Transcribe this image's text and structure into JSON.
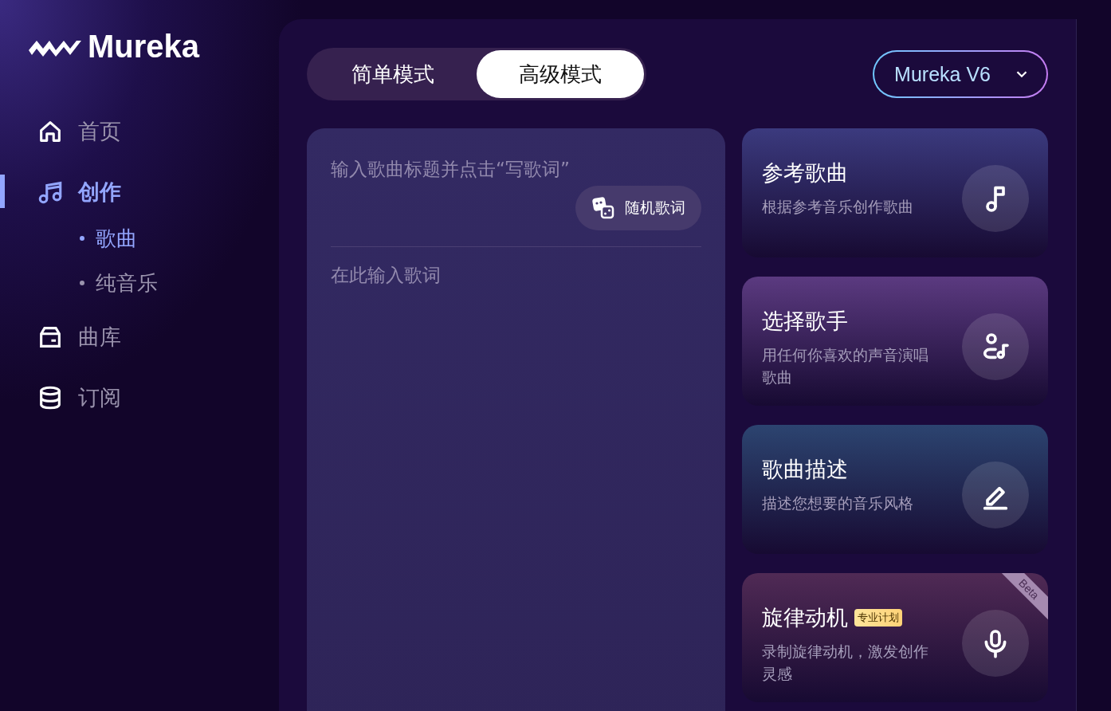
{
  "logo": {
    "text": "Mureka"
  },
  "sidebar": {
    "items": [
      {
        "label": "首页",
        "kind": "home",
        "selected": false
      },
      {
        "label": "创作",
        "kind": "music",
        "selected": true,
        "children": [
          {
            "label": "歌曲",
            "selected": true
          },
          {
            "label": "纯音乐",
            "selected": false
          }
        ]
      },
      {
        "label": "曲库",
        "kind": "box",
        "selected": false
      },
      {
        "label": "订阅",
        "kind": "database",
        "selected": false
      }
    ]
  },
  "mode_tabs": [
    {
      "label": "简单模式",
      "selected": false
    },
    {
      "label": "高级模式",
      "selected": true
    }
  ],
  "model_select": {
    "value": "Mureka V6"
  },
  "lyrics_editor": {
    "title_placeholder": "输入歌曲标题并点击“写歌词”",
    "random_button": "随机歌词",
    "lyrics_placeholder": "在此输入歌词"
  },
  "feature_cards": [
    {
      "title": "参考歌曲",
      "description": "根据参考音乐创作歌曲",
      "kind": "note",
      "color": "#3b3a7e"
    },
    {
      "title": "选择歌手",
      "description": "用任何你喜欢的声音演唱歌曲",
      "kind": "singer",
      "color": "#5b3a80"
    },
    {
      "title": "歌曲描述",
      "description": "描述您想要的音乐风格",
      "kind": "pen",
      "color": "#2c4470"
    },
    {
      "title": "旋律动机",
      "description": "录制旋律动机，激发创作灵感",
      "kind": "mic",
      "color": "#502a55",
      "tag": "专业计划",
      "corner": "Beta"
    }
  ]
}
